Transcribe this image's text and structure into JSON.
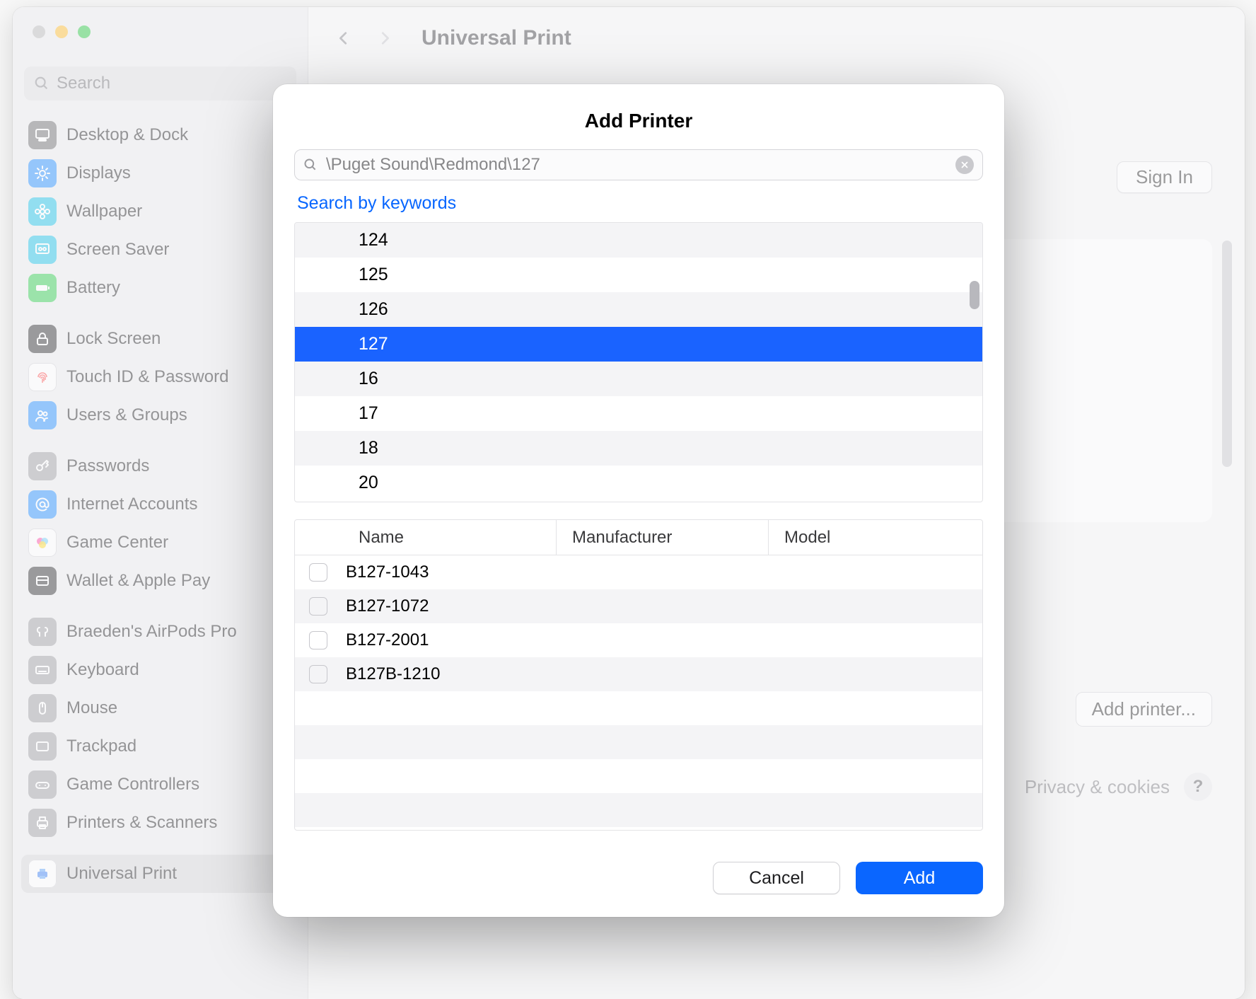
{
  "window": {
    "page_title": "Universal Print",
    "sidebar_search_placeholder": "Search"
  },
  "sidebar_groups": [
    [
      {
        "label": "Desktop & Dock",
        "icon": "#6a6a6e",
        "glyph": "grid"
      },
      {
        "label": "Displays",
        "icon": "#1f8cff",
        "glyph": "sun"
      },
      {
        "label": "Wallpaper",
        "icon": "#19c0e6",
        "glyph": "flower"
      },
      {
        "label": "Screen Saver",
        "icon": "#19c0e6",
        "glyph": "screensaver"
      },
      {
        "label": "Battery",
        "icon": "#2dcc4d",
        "glyph": "battery"
      }
    ],
    [
      {
        "label": "Lock Screen",
        "icon": "#2b2b2d",
        "glyph": "lock"
      },
      {
        "label": "Touch ID & Password",
        "icon": "#ffffff",
        "glyph": "fingerprint",
        "fg": "#ff5f57",
        "border": true
      },
      {
        "label": "Users & Groups",
        "icon": "#1f8cff",
        "glyph": "users"
      }
    ],
    [
      {
        "label": "Passwords",
        "icon": "#9c9ca1",
        "glyph": "key"
      },
      {
        "label": "Internet Accounts",
        "icon": "#1f8cff",
        "glyph": "at"
      },
      {
        "label": "Game Center",
        "icon": "#ffffff",
        "glyph": "gamecenter",
        "border": true
      },
      {
        "label": "Wallet & Apple Pay",
        "icon": "#2b2b2d",
        "glyph": "wallet"
      }
    ],
    [
      {
        "label": "Braeden's AirPods Pro",
        "icon": "#9c9ca1",
        "glyph": "airpods"
      },
      {
        "label": "Keyboard",
        "icon": "#9c9ca1",
        "glyph": "keyboard"
      },
      {
        "label": "Mouse",
        "icon": "#9c9ca1",
        "glyph": "mouse"
      },
      {
        "label": "Trackpad",
        "icon": "#9c9ca1",
        "glyph": "trackpad"
      },
      {
        "label": "Game Controllers",
        "icon": "#9c9ca1",
        "glyph": "controller"
      },
      {
        "label": "Printers & Scanners",
        "icon": "#9c9ca1",
        "glyph": "printer"
      }
    ],
    [
      {
        "label": "Universal Print",
        "icon": "#ffffff",
        "glyph": "uprint",
        "border": true,
        "selected": true
      }
    ]
  ],
  "main": {
    "sign_in": "Sign In",
    "add_printer_btn": "Add printer...",
    "privacy_link": "Privacy & cookies",
    "help": "?"
  },
  "modal": {
    "title": "Add Printer",
    "search_value": "\\Puget Sound\\Redmond\\127",
    "keywords_link": "Search by keywords",
    "locations": [
      "124",
      "125",
      "126",
      "127",
      "16",
      "17",
      "18",
      "20"
    ],
    "selected_location_index": 3,
    "table": {
      "headers": {
        "name": "Name",
        "manufacturer": "Manufacturer",
        "model": "Model"
      },
      "rows": [
        {
          "name": "B127-1043",
          "manufacturer": "",
          "model": ""
        },
        {
          "name": "B127-1072",
          "manufacturer": "",
          "model": ""
        },
        {
          "name": "B127-2001",
          "manufacturer": "",
          "model": ""
        },
        {
          "name": "B127B-1210",
          "manufacturer": "",
          "model": ""
        }
      ],
      "empty_rows": 4
    },
    "cancel": "Cancel",
    "add": "Add"
  }
}
